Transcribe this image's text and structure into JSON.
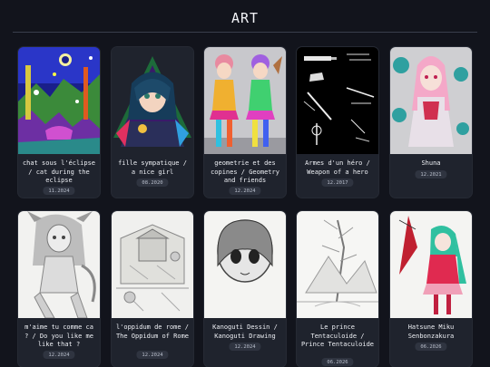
{
  "page": {
    "title": "ART"
  },
  "items": [
    {
      "caption": "chat sous l'éclipse / cat during the eclipse",
      "date": "11.2024"
    },
    {
      "caption": "fille sympatique / a nice girl",
      "date": "08.2020"
    },
    {
      "caption": "geometrie et des copines / Geometry and friends",
      "date": "12.2024"
    },
    {
      "caption": "Armes d'un héro / Weapon of a hero",
      "date": "12.2017"
    },
    {
      "caption": "Shuna",
      "date": "12.2021"
    },
    {
      "caption": "m'aime tu comme ca ? / Do you like me like that ?",
      "date": "12.2024"
    },
    {
      "caption": "l'oppidum de rome / The Oppidum of Rome",
      "date": "12.2024"
    },
    {
      "caption": "Kanoguti Dessin / Kanoguti Drawing",
      "date": "12.2024"
    },
    {
      "caption": "Le prince Tentaculoide / Prince Tentaculoide",
      "date": "06.2026"
    },
    {
      "caption": "Hatsune Miku Senbonzakura",
      "date": "06.2026"
    }
  ],
  "colors": {
    "background": "#12141c",
    "card": "#1f232d",
    "badge": "#2f3440"
  }
}
